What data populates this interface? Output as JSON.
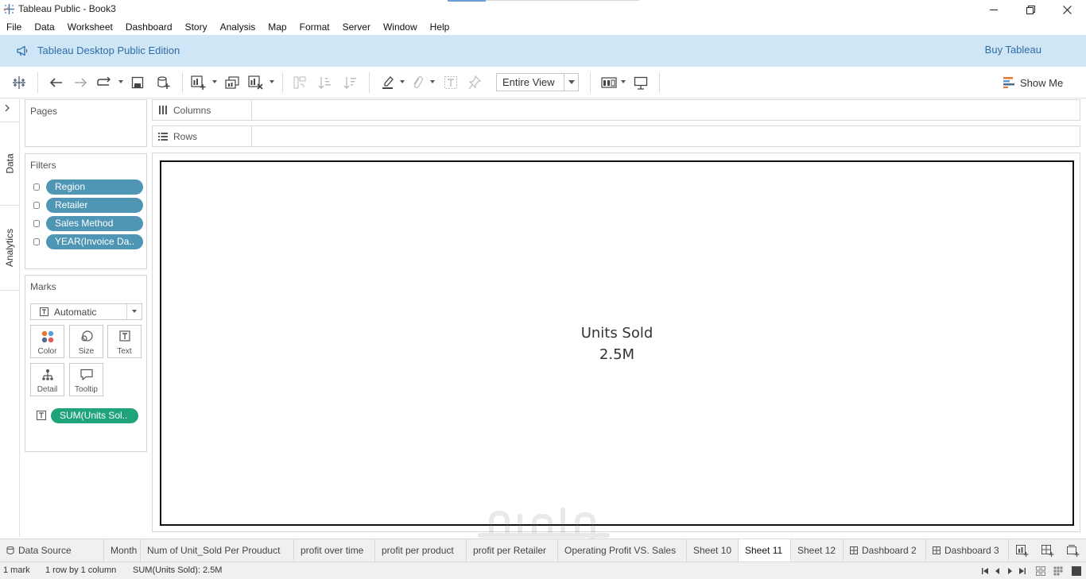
{
  "app": {
    "title": "Tableau Public - Book3"
  },
  "menu": [
    "File",
    "Data",
    "Worksheet",
    "Dashboard",
    "Story",
    "Analysis",
    "Map",
    "Format",
    "Server",
    "Window",
    "Help"
  ],
  "banner": {
    "text": "Tableau Desktop Public Edition",
    "buy_link": "Buy Tableau"
  },
  "toolbar": {
    "view_select": "Entire View",
    "show_me": "Show Me"
  },
  "side_tabs": {
    "data": "Data",
    "analytics": "Analytics"
  },
  "pages": {
    "title": "Pages"
  },
  "filters": {
    "title": "Filters",
    "items": [
      "Region",
      "Retailer",
      "Sales Method",
      "YEAR(Invoice Da.."
    ]
  },
  "marks": {
    "title": "Marks",
    "type": "Automatic",
    "buttons": [
      "Color",
      "Size",
      "Text",
      "Detail",
      "Tooltip"
    ],
    "field": "SUM(Units Sol.."
  },
  "shelves": {
    "columns": "Columns",
    "rows": "Rows"
  },
  "view": {
    "label": "Units Sold",
    "value": "2.5M"
  },
  "sheet_tabs": {
    "data_source": "Data Source",
    "tabs": [
      "Month",
      "Num of Unit_Sold Per Prouduct",
      "profit over time",
      "profit per product",
      "profit per Retailer",
      "Operating Profit VS. Sales",
      "Sheet 10",
      "Sheet 11",
      "Sheet 12",
      "Dashboard 2",
      "Dashboard 3"
    ],
    "active": "Sheet 11"
  },
  "status": {
    "marks": "1 mark",
    "dims": "1 row by 1 column",
    "sum": "SUM(Units Sold): 2.5M"
  },
  "watermark": {
    "latin": "mostaql.com"
  },
  "colors": {
    "filter_pill": "#4f96b5",
    "measure_pill": "#1fa37a",
    "banner_bg": "#cfe6f7",
    "banner_text": "#2e6da4"
  }
}
